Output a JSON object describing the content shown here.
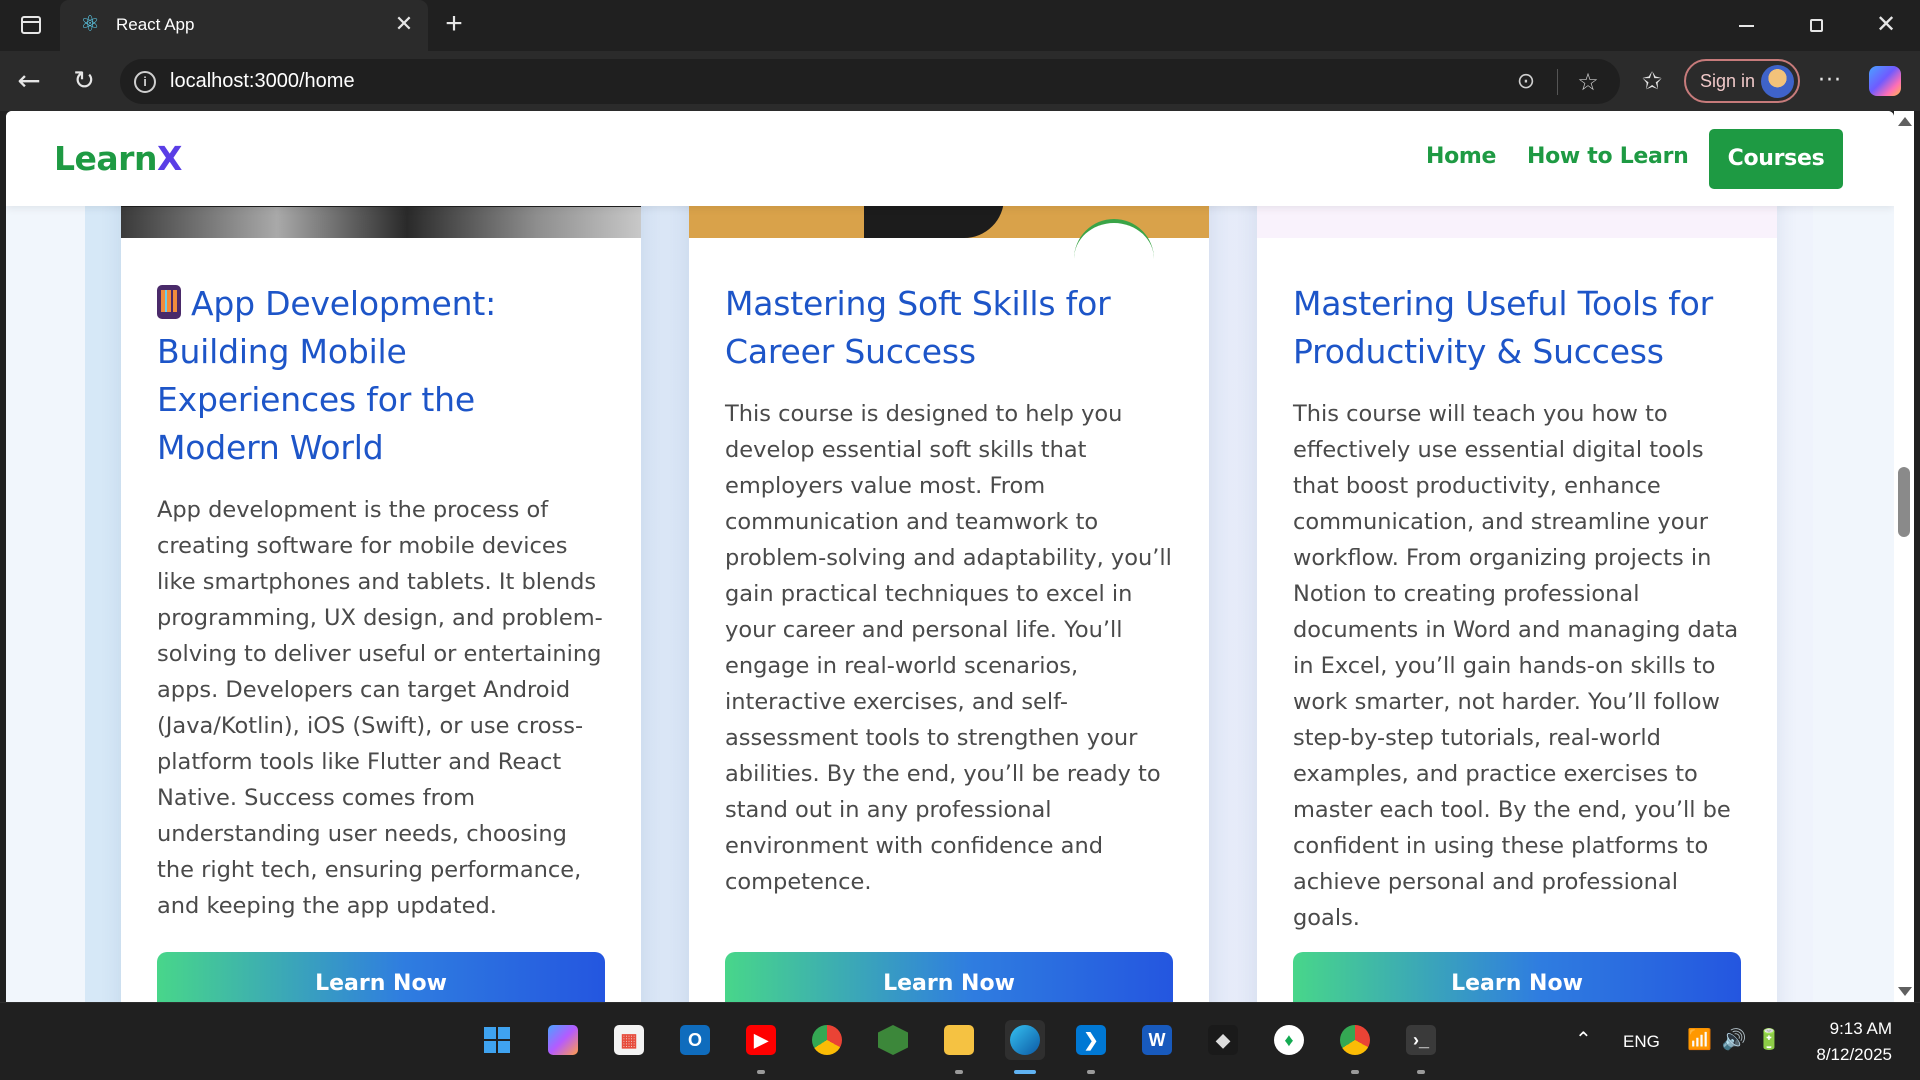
{
  "browser": {
    "tab_title": "React App",
    "url": "localhost:3000/home",
    "sign_in_label": "Sign in",
    "icons": {
      "tab_actions": "tab-actions-icon",
      "tab_favicon": "react-logo-icon",
      "tab_close": "close-icon",
      "new_tab": "plus-icon",
      "back": "back-arrow-icon",
      "reload": "reload-icon",
      "site_info": "info-icon",
      "reading_mode": "reading-mode-icon",
      "favorite": "star-icon",
      "favorites": "favorites-icon",
      "more": "more-icon",
      "copilot": "copilot-icon"
    }
  },
  "site": {
    "logo_part1": "Learn",
    "logo_part2": "X",
    "nav": {
      "home": "Home",
      "how_to_learn": "How to Learn",
      "courses": "Courses"
    },
    "colors": {
      "brand_green": "#1e9a43",
      "logo_accent": "#5a3ee6",
      "title_blue": "#1d55c8"
    }
  },
  "courses": [
    {
      "title": "App Development: Building Mobile Experiences for the Modern World",
      "title_icon": "mobile-phone-icon",
      "description": "App development is the process of creating software for mobile devices like smartphones and tablets. It blends programming, UX design, and problem-solving to deliver useful or entertaining apps. Developers can target Android (Java/Kotlin), iOS (Swift), or use cross-platform tools like Flutter and React Native. Success comes from understanding user needs, choosing the right tech, ensuring performance, and keeping the app updated.",
      "button": "Learn Now"
    },
    {
      "title": "Mastering Soft Skills for Career Success",
      "description": "This course is designed to help you develop essential soft skills that employers value most. From communication and teamwork to problem-solving and adaptability, you’ll gain practical techniques to excel in your career and personal life. You’ll engage in real-world scenarios, interactive exercises, and self-assessment tools to strengthen your abilities. By the end, you’ll be ready to stand out in any professional environment with confidence and competence.",
      "button": "Learn Now"
    },
    {
      "title": "Mastering Useful Tools for Productivity & Success",
      "description": "This course will teach you how to effectively use essential digital tools that boost productivity, enhance communication, and streamline your workflow. From organizing projects in Notion to creating professional documents in Word and managing data in Excel, you’ll gain hands-on skills to work smarter, not harder. You’ll follow step-by-step tutorials, real-world examples, and practice exercises to master each tool. By the end, you’ll be confident in using these platforms to achieve personal and professional goals.",
      "button": "Learn Now"
    }
  ],
  "taskbar": {
    "apps": [
      "windows-start-icon",
      "copilot-icon",
      "microsoft-store-icon",
      "outlook-icon",
      "youtube-icon",
      "chrome-icon",
      "nodejs-icon",
      "file-explorer-icon",
      "edge-icon",
      "vscode-icon",
      "word-icon",
      "cube-app-icon",
      "mongodb-icon",
      "chrome-profile-icon",
      "terminal-icon"
    ],
    "language": "ENG",
    "time": "9:13 AM",
    "date": "8/12/2025"
  }
}
